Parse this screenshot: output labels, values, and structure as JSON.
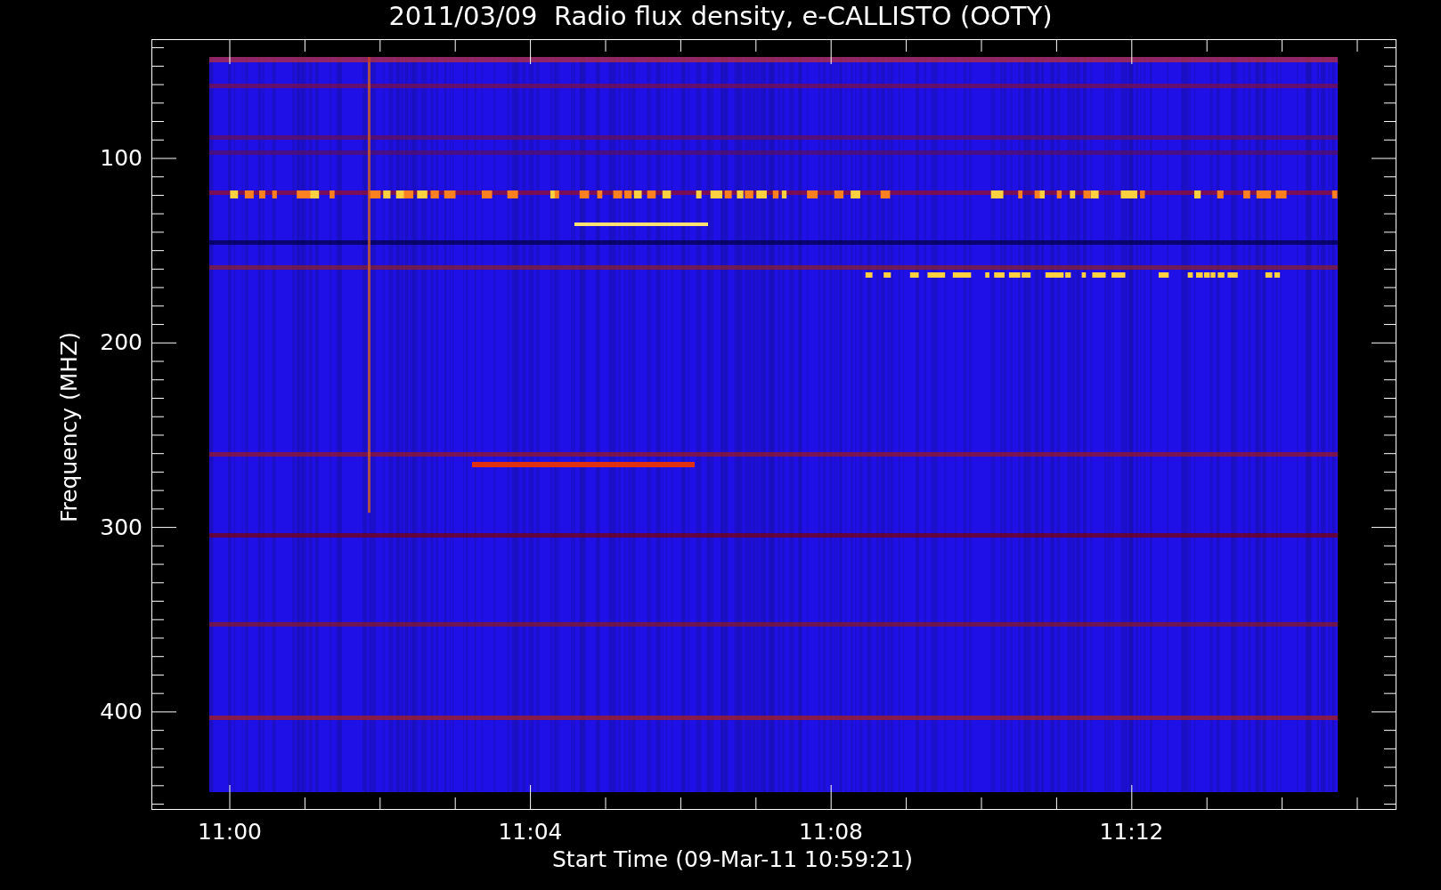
{
  "title": "2011/03/09  Radio flux density, e-CALLISTO (OOTY)",
  "y_axis": {
    "label": "Frequency (MHZ)",
    "ticks": [
      "100",
      "200",
      "300",
      "400"
    ]
  },
  "x_axis": {
    "label": "Start Time (09-Mar-11 10:59:21)",
    "ticks": [
      "11:00",
      "11:04",
      "11:08",
      "11:12"
    ]
  }
}
